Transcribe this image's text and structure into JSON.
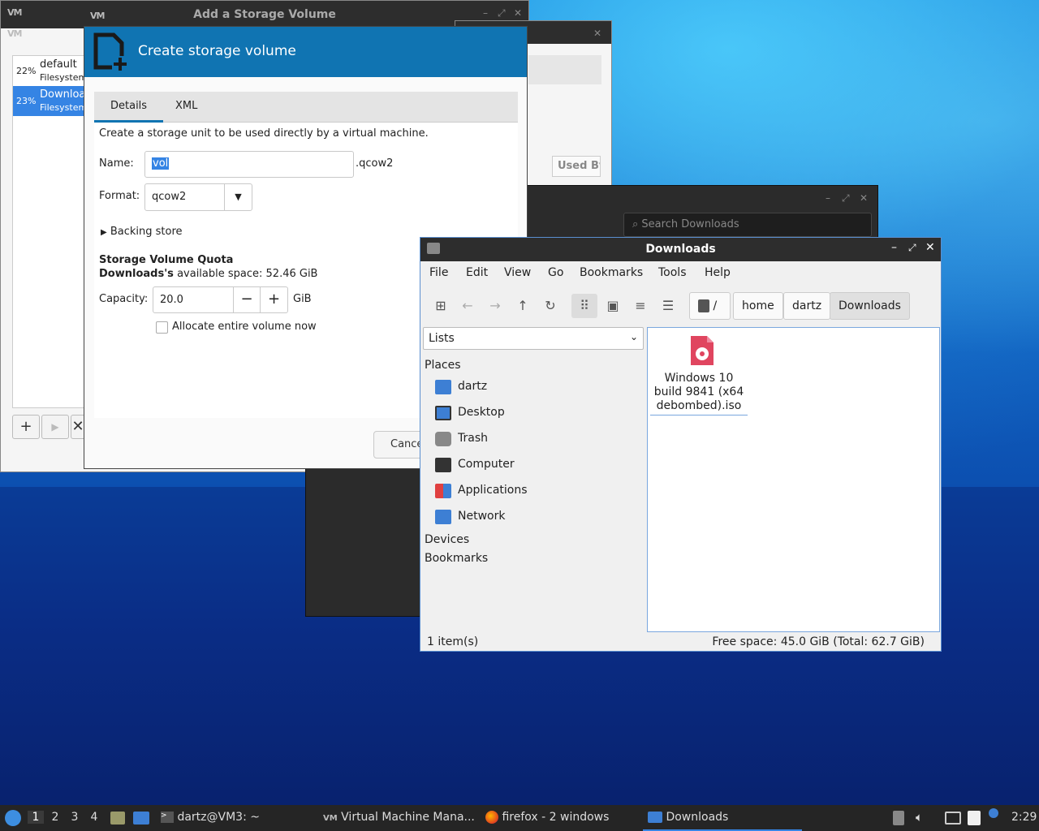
{
  "vm_window": {
    "title": "Add a Storage Volume",
    "logo": "VM",
    "pools": [
      {
        "pct": "22%",
        "name": "default",
        "type": "Filesystem"
      },
      {
        "pct": "23%",
        "name": "Downloads",
        "type": "Filesystem"
      }
    ],
    "column_header": "Used By",
    "add_icon": "plus-icon",
    "play_icon": "play-icon",
    "close_icon": "close-icon"
  },
  "search": {
    "placeholder": "Search Downloads"
  },
  "dialog": {
    "header_title": "Create storage volume",
    "tabs": [
      "Details",
      "XML"
    ],
    "description": "Create a storage unit to be used directly by a virtual machine.",
    "name_label": "Name:",
    "name_value": "vol",
    "name_suffix": ".qcow2",
    "format_label": "Format:",
    "format_value": "qcow2",
    "backing_store": "Backing store",
    "quota_title": "Storage Volume Quota",
    "quota_pool": "Downloads's",
    "quota_available": "available space: 52.46 GiB",
    "capacity_label": "Capacity:",
    "capacity_value": "20.0",
    "capacity_unit": "GiB",
    "allocate_label": "Allocate entire volume now",
    "allocate_checked": false,
    "cancel_label": "Cancel"
  },
  "file_manager": {
    "title": "Downloads",
    "menu": [
      "File",
      "Edit",
      "View",
      "Go",
      "Bookmarks",
      "Tools",
      "Help"
    ],
    "breadcrumb": [
      "/",
      "home",
      "dartz",
      "Downloads"
    ],
    "side_combo": "Lists",
    "places_heading": "Places",
    "places": [
      {
        "label": "dartz",
        "icon": "home-folder-icon",
        "color": "#3d7fd4"
      },
      {
        "label": "Desktop",
        "icon": "desktop-icon",
        "color": "#3d7fd4"
      },
      {
        "label": "Trash",
        "icon": "trash-icon",
        "color": "#888888"
      },
      {
        "label": "Computer",
        "icon": "computer-icon",
        "color": "#333333"
      },
      {
        "label": "Applications",
        "icon": "applications-icon",
        "color": "#e04040"
      },
      {
        "label": "Network",
        "icon": "network-folder-icon",
        "color": "#3d7fd4"
      }
    ],
    "devices_heading": "Devices",
    "bookmarks_heading": "Bookmarks",
    "files": [
      {
        "name_lines": [
          "Windows 10",
          "build 9841 (x64",
          "debombed).iso"
        ],
        "icon": "disc-image-icon"
      }
    ],
    "status_count": "1 item(s)",
    "status_space": "Free space: 45.0 GiB (Total: 62.7 GiB)"
  },
  "taskbar": {
    "workspaces": [
      "1",
      "2",
      "3",
      "4"
    ],
    "active_workspace": "1",
    "tasks": [
      {
        "label": "dartz@VM3: ~",
        "icon": "terminal-icon"
      },
      {
        "label": "Virtual Machine Mana...",
        "icon": "virt-manager-icon"
      },
      {
        "label": "firefox - 2 windows",
        "icon": "firefox-icon"
      },
      {
        "label": "Downloads",
        "icon": "folder-icon"
      }
    ],
    "clock": "2:29"
  }
}
